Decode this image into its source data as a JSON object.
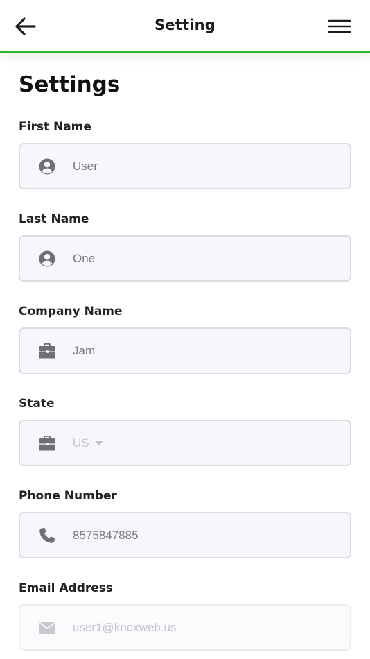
{
  "header": {
    "title": "Setting",
    "back_icon": "arrow-left-icon",
    "menu_icon": "hamburger-menu-icon",
    "accent_color": "#2db52d"
  },
  "page": {
    "title": "Settings"
  },
  "form": {
    "first_name": {
      "label": "First Name",
      "value": "User",
      "icon": "user-circle-icon"
    },
    "last_name": {
      "label": "Last Name",
      "value": "One",
      "icon": "user-circle-icon"
    },
    "company_name": {
      "label": "Company Name",
      "value": "Jam",
      "icon": "briefcase-icon"
    },
    "state": {
      "label": "State",
      "value": "US",
      "icon": "briefcase-icon"
    },
    "phone_number": {
      "label": "Phone Number",
      "value": "8575847885",
      "icon": "phone-icon"
    },
    "email_address": {
      "label": "Email Address",
      "value": "user1@knoxweb.us",
      "icon": "envelope-icon"
    }
  }
}
